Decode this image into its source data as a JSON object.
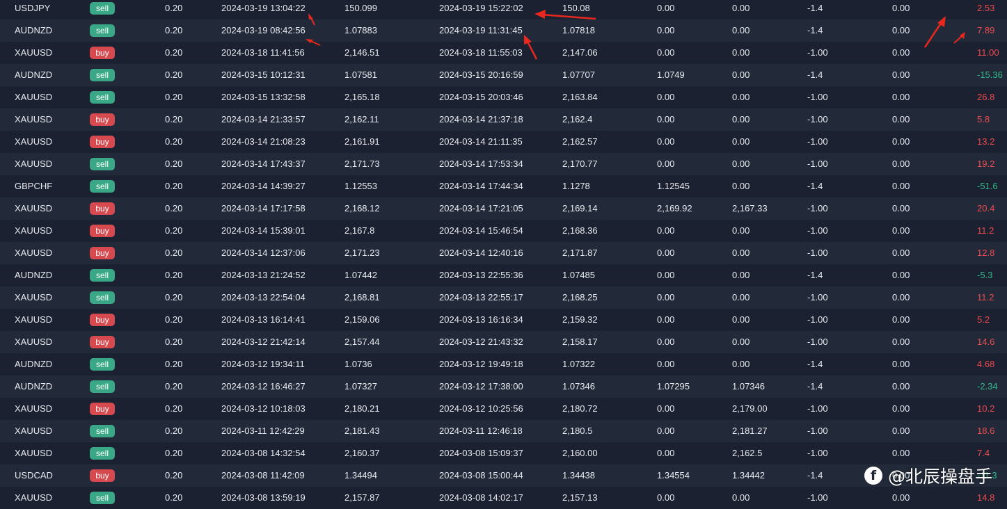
{
  "colors": {
    "sell_badge": "#3aa886",
    "buy_badge": "#d64a4f",
    "profit_positive": "#ef4a4f",
    "profit_negative": "#31b98a",
    "annotation_arrow": "#e8281e"
  },
  "watermark": {
    "icon": "f-logo-icon",
    "text": "@北辰操盘手"
  },
  "rows": [
    {
      "symbol": "USDJPY",
      "side": "sell",
      "lots": "0.20",
      "open_time": "2024-03-19 13:04:22",
      "open_price": "150.099",
      "close_time": "2024-03-19 15:22:02",
      "close_price": "150.08",
      "sl": "0.00",
      "tp": "0.00",
      "swap": "-1.4",
      "commission": "0.00",
      "profit": "2.53",
      "trend": "pos"
    },
    {
      "symbol": "AUDNZD",
      "side": "sell",
      "lots": "0.20",
      "open_time": "2024-03-19 08:42:56",
      "open_price": "1.07883",
      "close_time": "2024-03-19 11:31:45",
      "close_price": "1.07818",
      "sl": "0.00",
      "tp": "0.00",
      "swap": "-1.4",
      "commission": "0.00",
      "profit": "7.89",
      "trend": "pos"
    },
    {
      "symbol": "XAUUSD",
      "side": "buy",
      "lots": "0.20",
      "open_time": "2024-03-18 11:41:56",
      "open_price": "2,146.51",
      "close_time": "2024-03-18 11:55:03",
      "close_price": "2,147.06",
      "sl": "0.00",
      "tp": "0.00",
      "swap": "-1.00",
      "commission": "0.00",
      "profit": "11.00",
      "trend": "pos"
    },
    {
      "symbol": "AUDNZD",
      "side": "sell",
      "lots": "0.20",
      "open_time": "2024-03-15 10:12:31",
      "open_price": "1.07581",
      "close_time": "2024-03-15 20:16:59",
      "close_price": "1.07707",
      "sl": "1.0749",
      "tp": "0.00",
      "swap": "-1.4",
      "commission": "0.00",
      "profit": "-15.36",
      "trend": "neg"
    },
    {
      "symbol": "XAUUSD",
      "side": "sell",
      "lots": "0.20",
      "open_time": "2024-03-15 13:32:58",
      "open_price": "2,165.18",
      "close_time": "2024-03-15 20:03:46",
      "close_price": "2,163.84",
      "sl": "0.00",
      "tp": "0.00",
      "swap": "-1.00",
      "commission": "0.00",
      "profit": "26.8",
      "trend": "pos"
    },
    {
      "symbol": "XAUUSD",
      "side": "buy",
      "lots": "0.20",
      "open_time": "2024-03-14 21:33:57",
      "open_price": "2,162.11",
      "close_time": "2024-03-14 21:37:18",
      "close_price": "2,162.4",
      "sl": "0.00",
      "tp": "0.00",
      "swap": "-1.00",
      "commission": "0.00",
      "profit": "5.8",
      "trend": "pos"
    },
    {
      "symbol": "XAUUSD",
      "side": "buy",
      "lots": "0.20",
      "open_time": "2024-03-14 21:08:23",
      "open_price": "2,161.91",
      "close_time": "2024-03-14 21:11:35",
      "close_price": "2,162.57",
      "sl": "0.00",
      "tp": "0.00",
      "swap": "-1.00",
      "commission": "0.00",
      "profit": "13.2",
      "trend": "pos"
    },
    {
      "symbol": "XAUUSD",
      "side": "sell",
      "lots": "0.20",
      "open_time": "2024-03-14 17:43:37",
      "open_price": "2,171.73",
      "close_time": "2024-03-14 17:53:34",
      "close_price": "2,170.77",
      "sl": "0.00",
      "tp": "0.00",
      "swap": "-1.00",
      "commission": "0.00",
      "profit": "19.2",
      "trend": "pos"
    },
    {
      "symbol": "GBPCHF",
      "side": "sell",
      "lots": "0.20",
      "open_time": "2024-03-14 14:39:27",
      "open_price": "1.12553",
      "close_time": "2024-03-14 17:44:34",
      "close_price": "1.1278",
      "sl": "1.12545",
      "tp": "0.00",
      "swap": "-1.4",
      "commission": "0.00",
      "profit": "-51.6",
      "trend": "neg"
    },
    {
      "symbol": "XAUUSD",
      "side": "buy",
      "lots": "0.20",
      "open_time": "2024-03-14 17:17:58",
      "open_price": "2,168.12",
      "close_time": "2024-03-14 17:21:05",
      "close_price": "2,169.14",
      "sl": "2,169.92",
      "tp": "2,167.33",
      "swap": "-1.00",
      "commission": "0.00",
      "profit": "20.4",
      "trend": "pos"
    },
    {
      "symbol": "XAUUSD",
      "side": "buy",
      "lots": "0.20",
      "open_time": "2024-03-14 15:39:01",
      "open_price": "2,167.8",
      "close_time": "2024-03-14 15:46:54",
      "close_price": "2,168.36",
      "sl": "0.00",
      "tp": "0.00",
      "swap": "-1.00",
      "commission": "0.00",
      "profit": "11.2",
      "trend": "pos"
    },
    {
      "symbol": "XAUUSD",
      "side": "buy",
      "lots": "0.20",
      "open_time": "2024-03-14 12:37:06",
      "open_price": "2,171.23",
      "close_time": "2024-03-14 12:40:16",
      "close_price": "2,171.87",
      "sl": "0.00",
      "tp": "0.00",
      "swap": "-1.00",
      "commission": "0.00",
      "profit": "12.8",
      "trend": "pos"
    },
    {
      "symbol": "AUDNZD",
      "side": "sell",
      "lots": "0.20",
      "open_time": "2024-03-13 21:24:52",
      "open_price": "1.07442",
      "close_time": "2024-03-13 22:55:36",
      "close_price": "1.07485",
      "sl": "0.00",
      "tp": "0.00",
      "swap": "-1.4",
      "commission": "0.00",
      "profit": "-5.3",
      "trend": "neg"
    },
    {
      "symbol": "XAUUSD",
      "side": "sell",
      "lots": "0.20",
      "open_time": "2024-03-13 22:54:04",
      "open_price": "2,168.81",
      "close_time": "2024-03-13 22:55:17",
      "close_price": "2,168.25",
      "sl": "0.00",
      "tp": "0.00",
      "swap": "-1.00",
      "commission": "0.00",
      "profit": "11.2",
      "trend": "pos"
    },
    {
      "symbol": "XAUUSD",
      "side": "buy",
      "lots": "0.20",
      "open_time": "2024-03-13 16:14:41",
      "open_price": "2,159.06",
      "close_time": "2024-03-13 16:16:34",
      "close_price": "2,159.32",
      "sl": "0.00",
      "tp": "0.00",
      "swap": "-1.00",
      "commission": "0.00",
      "profit": "5.2",
      "trend": "pos"
    },
    {
      "symbol": "XAUUSD",
      "side": "buy",
      "lots": "0.20",
      "open_time": "2024-03-12 21:42:14",
      "open_price": "2,157.44",
      "close_time": "2024-03-12 21:43:32",
      "close_price": "2,158.17",
      "sl": "0.00",
      "tp": "0.00",
      "swap": "-1.00",
      "commission": "0.00",
      "profit": "14.6",
      "trend": "pos"
    },
    {
      "symbol": "AUDNZD",
      "side": "sell",
      "lots": "0.20",
      "open_time": "2024-03-12 19:34:11",
      "open_price": "1.0736",
      "close_time": "2024-03-12 19:49:18",
      "close_price": "1.07322",
      "sl": "0.00",
      "tp": "0.00",
      "swap": "-1.4",
      "commission": "0.00",
      "profit": "4.68",
      "trend": "pos"
    },
    {
      "symbol": "AUDNZD",
      "side": "sell",
      "lots": "0.20",
      "open_time": "2024-03-12 16:46:27",
      "open_price": "1.07327",
      "close_time": "2024-03-12 17:38:00",
      "close_price": "1.07346",
      "sl": "1.07295",
      "tp": "1.07346",
      "swap": "-1.4",
      "commission": "0.00",
      "profit": "-2.34",
      "trend": "neg"
    },
    {
      "symbol": "XAUUSD",
      "side": "buy",
      "lots": "0.20",
      "open_time": "2024-03-12 10:18:03",
      "open_price": "2,180.21",
      "close_time": "2024-03-12 10:25:56",
      "close_price": "2,180.72",
      "sl": "0.00",
      "tp": "2,179.00",
      "swap": "-1.00",
      "commission": "0.00",
      "profit": "10.2",
      "trend": "pos"
    },
    {
      "symbol": "XAUUSD",
      "side": "sell",
      "lots": "0.20",
      "open_time": "2024-03-11 12:42:29",
      "open_price": "2,181.43",
      "close_time": "2024-03-11 12:46:18",
      "close_price": "2,180.5",
      "sl": "0.00",
      "tp": "2,181.27",
      "swap": "-1.00",
      "commission": "0.00",
      "profit": "18.6",
      "trend": "pos"
    },
    {
      "symbol": "XAUUSD",
      "side": "sell",
      "lots": "0.20",
      "open_time": "2024-03-08 14:32:54",
      "open_price": "2,160.37",
      "close_time": "2024-03-08 15:09:37",
      "close_price": "2,160.00",
      "sl": "0.00",
      "tp": "2,162.5",
      "swap": "-1.00",
      "commission": "0.00",
      "profit": "7.4",
      "trend": "pos"
    },
    {
      "symbol": "USDCAD",
      "side": "buy",
      "lots": "0.20",
      "open_time": "2024-03-08 11:42:09",
      "open_price": "1.34494",
      "close_time": "2024-03-08 15:00:44",
      "close_price": "1.34438",
      "sl": "1.34554",
      "tp": "1.34442",
      "swap": "-1.4",
      "commission": "0.00",
      "profit": "-11.3",
      "trend": "neg"
    },
    {
      "symbol": "XAUUSD",
      "side": "sell",
      "lots": "0.20",
      "open_time": "2024-03-08 13:59:19",
      "open_price": "2,157.87",
      "close_time": "2024-03-08 14:02:17",
      "close_price": "2,157.13",
      "sl": "0.00",
      "tp": "0.00",
      "swap": "-1.00",
      "commission": "0.00",
      "profit": "14.8",
      "trend": "pos"
    }
  ]
}
